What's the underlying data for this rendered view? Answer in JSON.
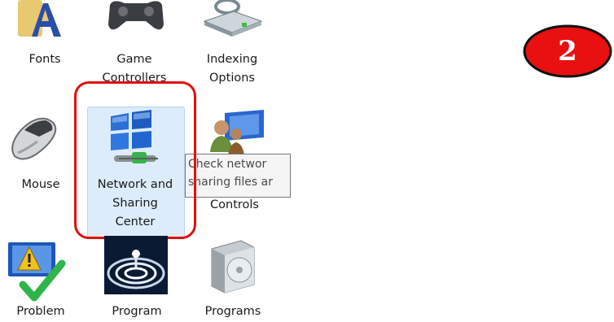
{
  "items": {
    "fonts": {
      "label": "Fonts"
    },
    "game_controllers": {
      "label_line1": "Game",
      "label_line2": "Controllers"
    },
    "indexing": {
      "label_line1": "Indexing",
      "label_line2": "Options"
    },
    "mouse": {
      "label": "Mouse"
    },
    "network": {
      "label_line1": "Network and",
      "label_line2": "Sharing",
      "label_line3": "Center"
    },
    "parental": {
      "label": "Controls"
    },
    "problem": {
      "label": "Problem"
    },
    "program": {
      "label": "Program"
    },
    "programs": {
      "label": "Programs"
    }
  },
  "tooltip": {
    "line1": "Check networ",
    "line2": "sharing files ar"
  },
  "badge": {
    "text": "2",
    "color": "#e81010"
  },
  "colors": {
    "highlight": "#dcecfb",
    "annotation_red": "#e01010"
  }
}
